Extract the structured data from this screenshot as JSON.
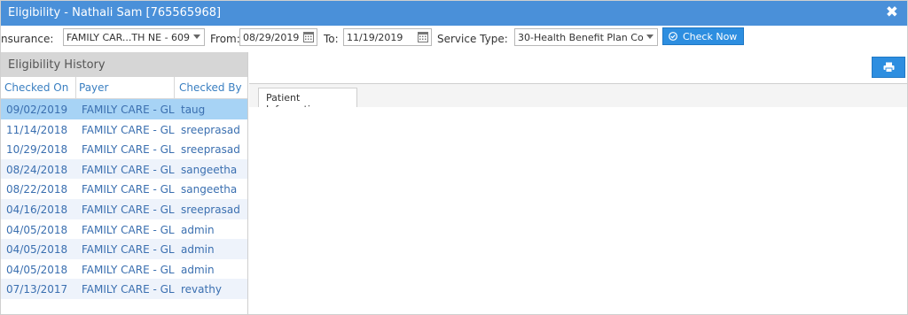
{
  "window": {
    "title": "Eligibility - Nathali Sam [765565968]",
    "close_icon": "close-icon"
  },
  "toolbar": {
    "insurance_label": "nsurance:",
    "insurance_value": "FAMILY CAR...TH NE - 609",
    "from_label": "From:",
    "from_value": "08/29/2019",
    "to_label": "To:",
    "to_value": "11/19/2019",
    "service_type_label": "Service Type:",
    "service_type_value": "30-Health Benefit Plan Co",
    "check_now_label": "Check Now"
  },
  "history": {
    "title": "Eligibility History",
    "columns": [
      "Checked On",
      "Payer",
      "Checked By"
    ],
    "rows": [
      {
        "checked_on": "09/02/2019",
        "payer": "FAMILY CARE - GL(",
        "checked_by": "taug",
        "selected": true
      },
      {
        "checked_on": "11/14/2018",
        "payer": "FAMILY CARE - GL(",
        "checked_by": "sreeprasad"
      },
      {
        "checked_on": "10/29/2018",
        "payer": "FAMILY CARE - GL(",
        "checked_by": "sreeprasad"
      },
      {
        "checked_on": "08/24/2018",
        "payer": "FAMILY CARE - GL(",
        "checked_by": "sangeetha"
      },
      {
        "checked_on": "08/22/2018",
        "payer": "FAMILY CARE - GL(",
        "checked_by": "sangeetha"
      },
      {
        "checked_on": "04/16/2018",
        "payer": "FAMILY CARE - GL(",
        "checked_by": "sreeprasad"
      },
      {
        "checked_on": "04/05/2018",
        "payer": "FAMILY CARE - GL(",
        "checked_by": "admin"
      },
      {
        "checked_on": "04/05/2018",
        "payer": "FAMILY CARE - GL(",
        "checked_by": "admin"
      },
      {
        "checked_on": "04/05/2018",
        "payer": "FAMILY CARE - GL(",
        "checked_by": "admin"
      },
      {
        "checked_on": "07/13/2017",
        "payer": "FAMILY CARE - GL(",
        "checked_by": "revathy"
      }
    ]
  },
  "detail": {
    "tabs": [
      {
        "label": "Patient Information",
        "active": true
      }
    ],
    "print_icon": "print-icon"
  },
  "colors": {
    "titlebar": "#4a90d9",
    "button": "#2d8ee0",
    "selected_row": "#a7d3f5",
    "alt_row": "#eef3fb",
    "link_text": "#3a6fb0"
  }
}
